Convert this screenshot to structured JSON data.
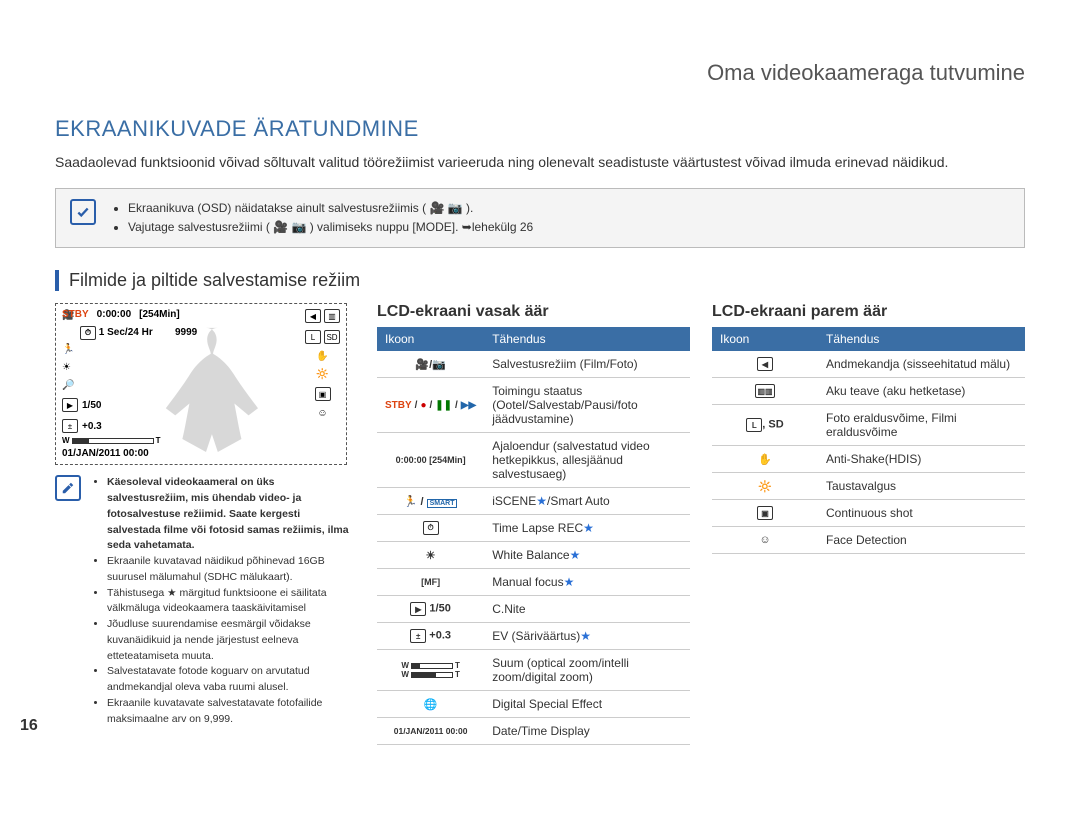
{
  "header": {
    "chapter": "Oma videokaameraga tutvumine"
  },
  "title": "EKRAANIKUVADE ÄRATUNDMINE",
  "intro": "Saadaolevad funktsioonid võivad sõltuvalt valitud töörežiimist varieeruda ning olenevalt seadistuste väärtustest võivad ilmuda erinevad näidikud.",
  "note_box": {
    "items": [
      "Ekraanikuva (OSD) näidatakse ainult salvestusrežiimis ( 🎥 📷 ).",
      "Vajutage salvestusrežiimi ( 🎥 📷 ) valimiseks nuppu [MODE]. ➥lehekülg 26"
    ]
  },
  "section_title": "Filmide ja piltide salvestamise režiim",
  "lcd": {
    "stby": "STBY",
    "time": "0:00:00",
    "remain": "[254Min]",
    "sec_hr": "1 Sec/24 Hr",
    "shots": "9999",
    "cnite": "1/50",
    "ev": "+0.3",
    "w": "W",
    "t": "T",
    "date": "01/JAN/2011 00:00"
  },
  "left_note": {
    "items": [
      {
        "text": "Käesoleval videokaameral on üks salvestusrežiim, mis ühendab video- ja fotosalvestuse režiimid. Saate kergesti salvestada filme või fotosid samas režiimis, ilma seda vahetamata.",
        "bold": true
      },
      {
        "text": "Ekraanile kuvatavad näidikud põhinevad 16GB suurusel mälumahul (SDHC mälukaart)."
      },
      {
        "text": "Tähistusega ★ märgitud funktsioone ei säilitata välkmäluga videokaamera taaskäivitamisel"
      },
      {
        "text": "Jõudluse suurendamise eesmärgil võidakse kuvanäidikuid ja nende järjestust eelneva etteteatamiseta muuta."
      },
      {
        "text": "Salvestatavate fotode koguarv on arvutatud andmekandjal oleva vaba ruumi alusel."
      },
      {
        "text": "Ekraanile kuvatavate salvestatavate fotofailide maksimaalne arv on 9,999."
      }
    ]
  },
  "left_table": {
    "heading": "LCD-ekraani vasak äär",
    "col_icon": "Ikoon",
    "col_meaning": "Tähendus",
    "rows": [
      {
        "icon": "film-photo",
        "label": "",
        "meaning": "Salvestusrežiim (Film/Foto)"
      },
      {
        "icon": "status",
        "label": "STBY / ● / ❚❚ / ▶▶",
        "meaning": "Toimingu staatus (Ootel/Salvestab/Pausi/foto jäädvustamine)"
      },
      {
        "icon": "text",
        "label": "0:00:00 [254Min]",
        "meaning": "Ajaloendur (salvestatud video hetkepikkus, allesjäänud salvestusaeg)"
      },
      {
        "icon": "iscene",
        "label": "",
        "meaning": "iSCENE★/Smart Auto"
      },
      {
        "icon": "timelapse",
        "label": "",
        "meaning": "Time Lapse REC★"
      },
      {
        "icon": "wb",
        "label": "",
        "meaning": "White Balance★"
      },
      {
        "icon": "mf",
        "label": "",
        "meaning": "Manual focus★"
      },
      {
        "icon": "cnite",
        "label": "1/50",
        "meaning": "C.Nite"
      },
      {
        "icon": "ev",
        "label": "+0.3",
        "meaning": "EV (Säriväärtus)★"
      },
      {
        "icon": "zoom-bars",
        "label": "W ▭ T",
        "meaning": "Suum (optical zoom/intelli zoom/digital zoom)"
      },
      {
        "icon": "dse",
        "label": "",
        "meaning": "Digital Special Effect"
      },
      {
        "icon": "text",
        "label": "01/JAN/2011 00:00",
        "meaning": "Date/Time Display"
      }
    ]
  },
  "right_table": {
    "heading": "LCD-ekraani parem äär",
    "col_icon": "Ikoon",
    "col_meaning": "Tähendus",
    "rows": [
      {
        "icon": "card",
        "label": "",
        "meaning": "Andmekandja (sisseehitatud mälu)"
      },
      {
        "icon": "battery",
        "label": "",
        "meaning": "Aku teave (aku hetketase)"
      },
      {
        "icon": "resolution",
        "label": ", SD",
        "meaning": "Foto eraldusvõime, Filmi eraldusvõime"
      },
      {
        "icon": "antishake",
        "label": "",
        "meaning": "Anti-Shake(HDIS)"
      },
      {
        "icon": "backlight",
        "label": "",
        "meaning": "Taustavalgus"
      },
      {
        "icon": "continuous",
        "label": "",
        "meaning": "Continuous shot"
      },
      {
        "icon": "face",
        "label": "",
        "meaning": "Face Detection"
      }
    ]
  },
  "page_number": "16"
}
